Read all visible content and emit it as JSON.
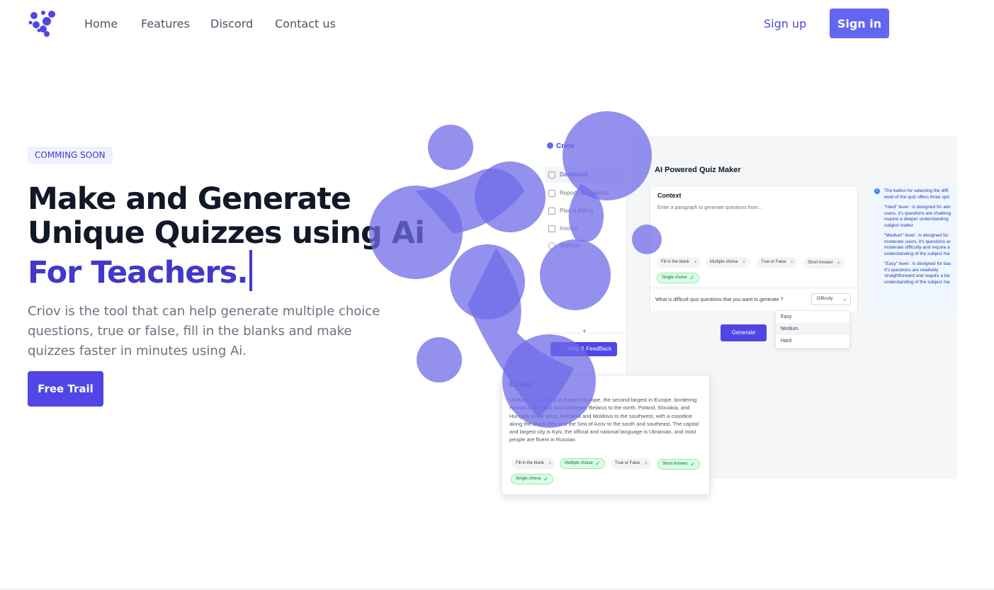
{
  "nav": {
    "links": [
      "Home",
      "Features",
      "Discord",
      "Contact us"
    ],
    "signup": "Sign up",
    "signin": "Sign in"
  },
  "hero": {
    "badge": "COMMING SOON",
    "headline_line1": "Make and Generate",
    "headline_line2": "Unique Quizzes using Ai",
    "headline_line3": "For Teachers.",
    "description": "Criov is the tool that can help generate multiple choice questions, true or false, fill in the blanks and make quizzes faster in minutes using Ai.",
    "cta": "Free Trail"
  },
  "mockup": {
    "brand": "Criov",
    "sidebar": [
      "Dashboard",
      "Reports & Analytics",
      "Plan & Billing",
      "Invoice",
      "Settings"
    ],
    "plus": "+",
    "help": "Help & FeedBack",
    "title": "AI Powered Quiz Maker",
    "context_label": "Context",
    "context_placeholder": "Enter a paragraph to generate questions from...",
    "pills": [
      "Fill in the blank",
      "Multiple choise",
      "True or False",
      "Short Answer",
      "Single choise"
    ],
    "question": "What is difficult quiz questions that you want to generate ?",
    "difficulty": "Difficulty",
    "generate": "Generate",
    "dropdown": [
      "Easy",
      "Medium",
      "Hard"
    ],
    "info": [
      "The button for selecting the diffi\nlevel of the quiz offers three opti",
      "\"Hard\" level : is designed for adv\nusers, it's questions are challeng\nrequire a deeper understanding \nsubject matter.",
      "\"Medium\" level : is designed for\nmoderate users, it's questions ar\nmoderate difficulty and require a\nunderstanding of the subject ma",
      "\"Easy\" level : is designed for bas\nIt's questions are relatively\nstraightforward and require a ba\nunderstanding of the subject ma"
    ]
  },
  "float_card": {
    "label": "Context",
    "body": "Ukraine is a country in Eastern Europe, the second-largest in Europe, bordering Russia to the east and northeast, Belarus to the north, Poland, Slovakia, and Hungary to the west, Romania and Moldova to the southwest, with a coastline along the Black Sea and the Sea of Azov to the south and southeast. The capital and largest city is Kyiv, the official and national language is Ukrainian, and most people are fluent in Russian.",
    "pills": [
      "Fill in the blank",
      "Multiple choise",
      "True or False",
      "Short Answer",
      "Single choise"
    ]
  },
  "colors": {
    "brand": "#4f46e5",
    "accent": "#6366f1",
    "blob": "#7c78ec"
  },
  "icons": [
    "logo-icon",
    "home-icon",
    "chart-icon",
    "card-icon",
    "invoice-icon",
    "gear-icon",
    "help-icon",
    "info-icon",
    "plus-icon",
    "check-icon",
    "chevron-down-icon"
  ]
}
